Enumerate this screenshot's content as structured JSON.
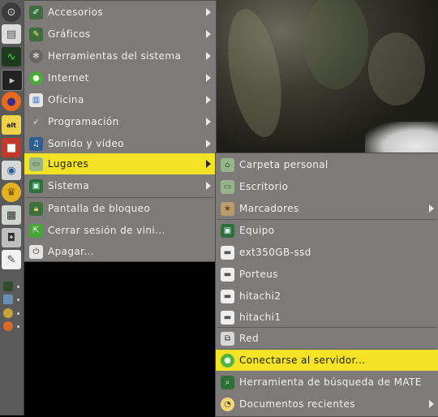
{
  "colors": {
    "menu_bg": "#7d7a79",
    "highlight": "#f4e325",
    "launcher_bg": "#5a5a5a",
    "desktop_bg": "#000000"
  },
  "main_menu": {
    "items": [
      {
        "label": "Accesorios",
        "icon": "accessories-icon",
        "submenu": true
      },
      {
        "label": "Gráficos",
        "icon": "graphics-icon",
        "submenu": true
      },
      {
        "label": "Herramientas del sistema",
        "icon": "system-tools-icon",
        "submenu": true
      },
      {
        "label": "Internet",
        "icon": "internet-icon",
        "submenu": true
      },
      {
        "label": "Oficina",
        "icon": "office-icon",
        "submenu": true
      },
      {
        "label": "Programación",
        "icon": "programming-icon",
        "submenu": true
      },
      {
        "label": "Sonido y vídeo",
        "icon": "multimedia-icon",
        "submenu": true
      },
      {
        "label": "Lugares",
        "icon": "folder-icon",
        "submenu": true,
        "highlighted": true
      },
      {
        "label": "Sistema",
        "icon": "system-icon",
        "submenu": true
      },
      {
        "label": "Pantalla de bloqueo",
        "icon": "lock-screen-icon",
        "submenu": false
      },
      {
        "label": "Cerrar sesión de vini...",
        "icon": "logout-icon",
        "submenu": false
      },
      {
        "label": "Apagar...",
        "icon": "shutdown-icon",
        "submenu": false
      }
    ]
  },
  "places_menu": {
    "items": [
      {
        "label": "Carpeta personal",
        "icon": "home-folder-icon"
      },
      {
        "label": "Escritorio",
        "icon": "desktop-icon"
      },
      {
        "label": "Marcadores",
        "icon": "bookmarks-icon",
        "submenu": true
      },
      {
        "label": "Equipo",
        "icon": "computer-icon"
      },
      {
        "label": "ext350GB-ssd",
        "icon": "drive-icon"
      },
      {
        "label": "Porteus",
        "icon": "drive-icon"
      },
      {
        "label": "hitachi2",
        "icon": "drive-icon"
      },
      {
        "label": "hitachi1",
        "icon": "drive-icon"
      },
      {
        "label": "Red",
        "icon": "network-icon"
      },
      {
        "label": "Conectarse al servidor...",
        "icon": "connect-server-icon",
        "highlighted": true
      },
      {
        "label": "Herramienta de búsqueda de MATE",
        "icon": "search-tool-icon"
      },
      {
        "label": "Documentos recientes",
        "icon": "recent-documents-icon",
        "submenu": true
      }
    ]
  },
  "launcher": {
    "icons": [
      "menu-icon",
      "file-manager-icon",
      "system-monitor-icon",
      "terminal-icon",
      "firefox-icon",
      "alt-linux-icon",
      "package-manager-icon",
      "settings-icon",
      "cup-icon",
      "calculator-icon",
      "screenshot-icon",
      "text-editor-icon"
    ]
  }
}
